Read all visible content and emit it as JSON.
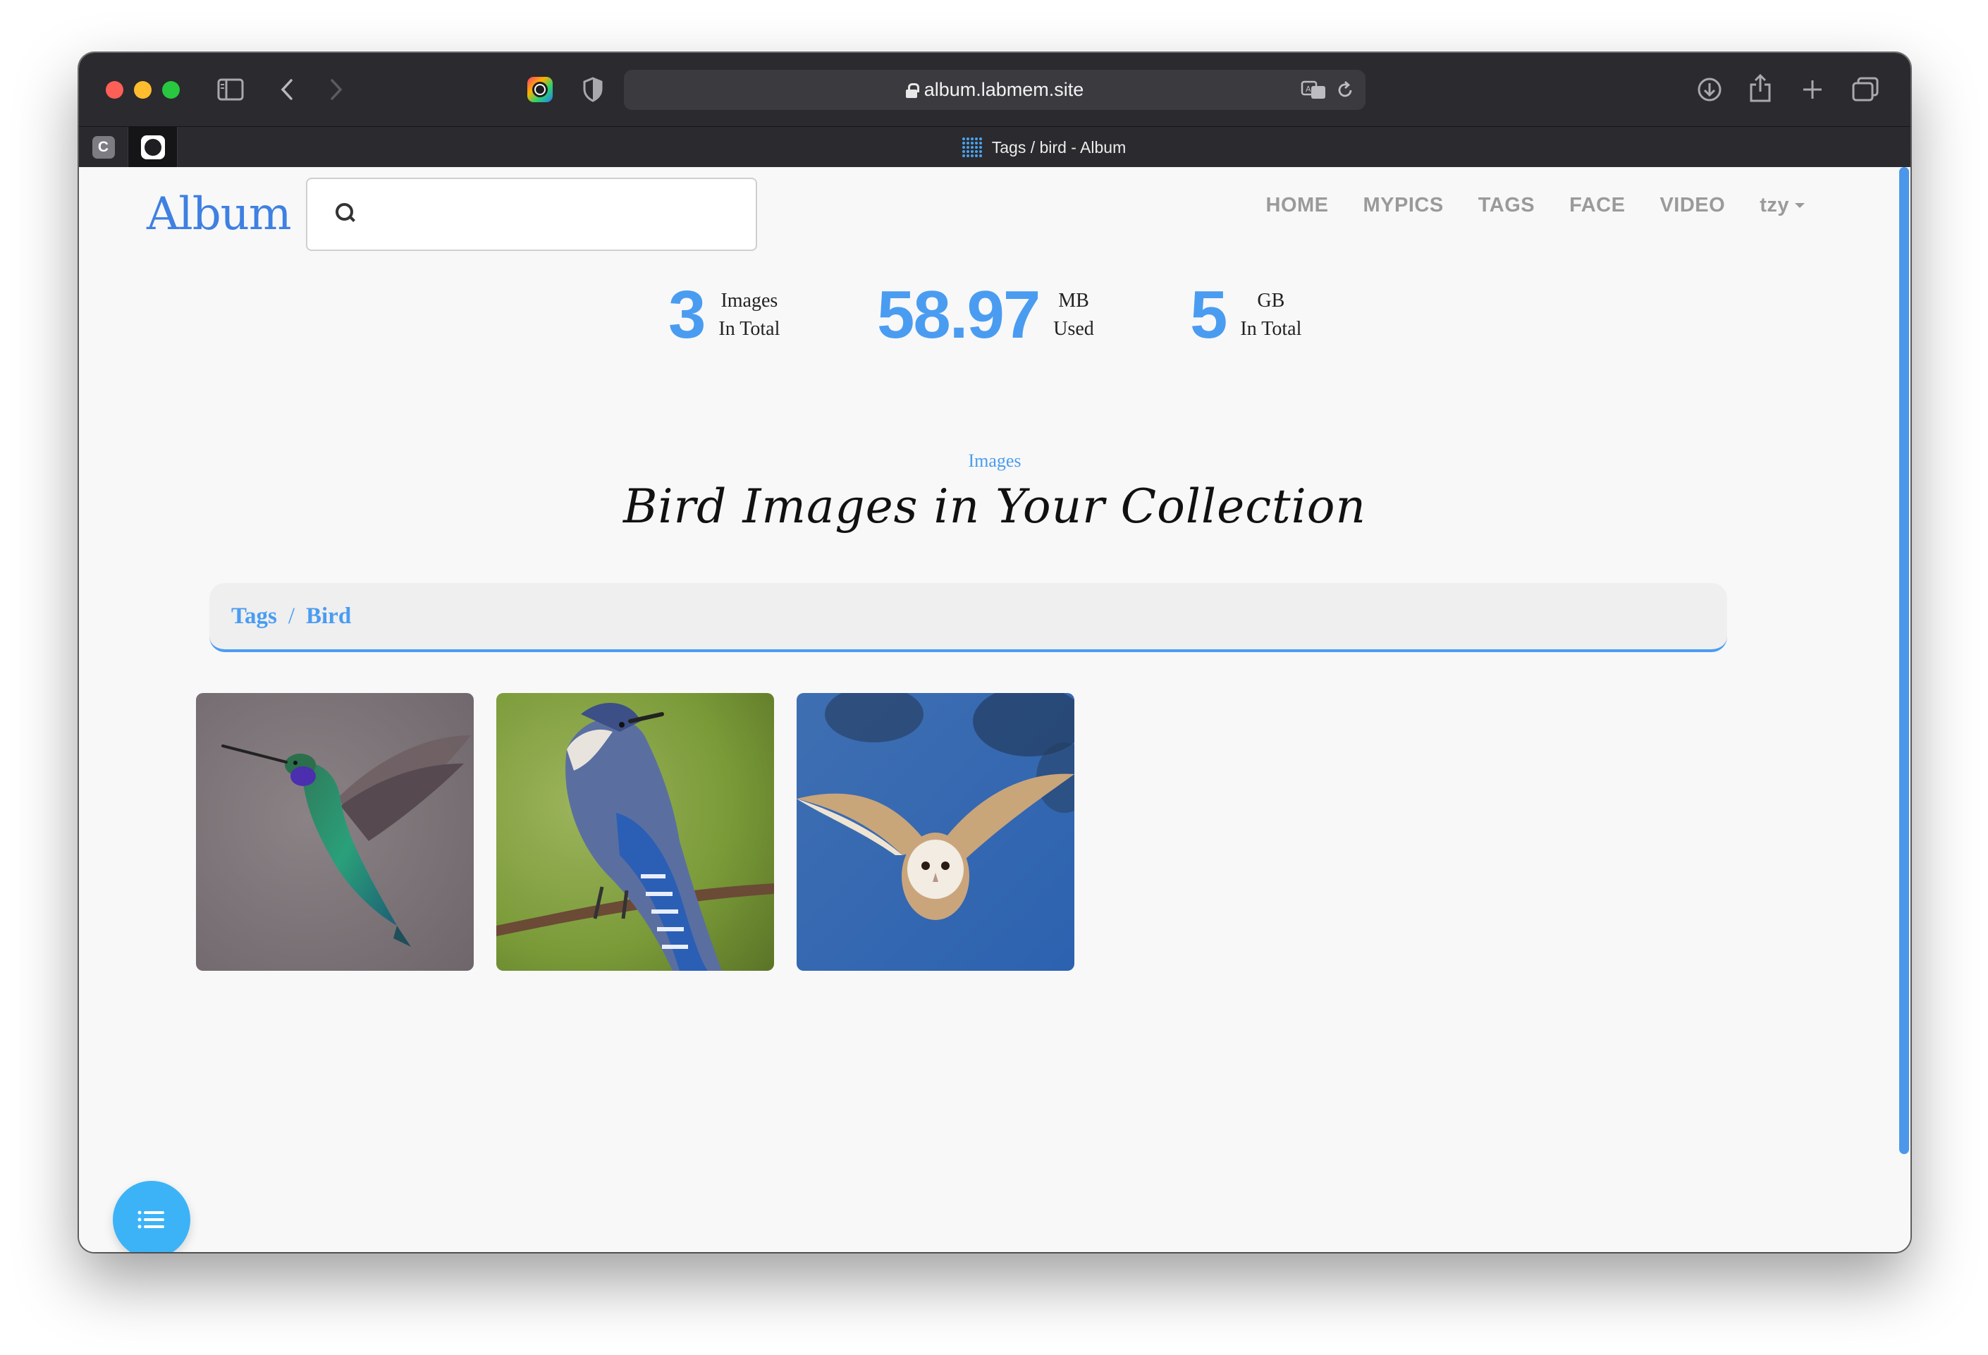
{
  "browser": {
    "url": "album.labmem.site",
    "tab_title": "Tags / bird - Album",
    "pinned_tabs": [
      {
        "label": "C"
      },
      {
        "label": ""
      }
    ]
  },
  "header": {
    "logo": "Album",
    "search": {
      "value": "",
      "placeholder": ""
    },
    "nav": [
      "HOME",
      "MYPICS",
      "TAGS",
      "FACE",
      "VIDEO"
    ],
    "user": "tzy"
  },
  "stats": [
    {
      "value": "3",
      "label_top": "Images",
      "label_bottom": "In Total"
    },
    {
      "value": "58.97",
      "label_top": "MB",
      "label_bottom": "Used"
    },
    {
      "value": "5",
      "label_top": "GB",
      "label_bottom": "In Total"
    }
  ],
  "section": {
    "eyebrow": "Images",
    "heading": "Bird Images in Your Collection"
  },
  "breadcrumb": {
    "items": [
      "Tags",
      "Bird"
    ],
    "separator": "/"
  },
  "images": [
    {
      "subject": "hummingbird"
    },
    {
      "subject": "blue jay"
    },
    {
      "subject": "barn owl"
    }
  ],
  "colors": {
    "accent": "#4a9cf1",
    "logo": "#3f80e2",
    "fab": "#3cb3f7"
  }
}
